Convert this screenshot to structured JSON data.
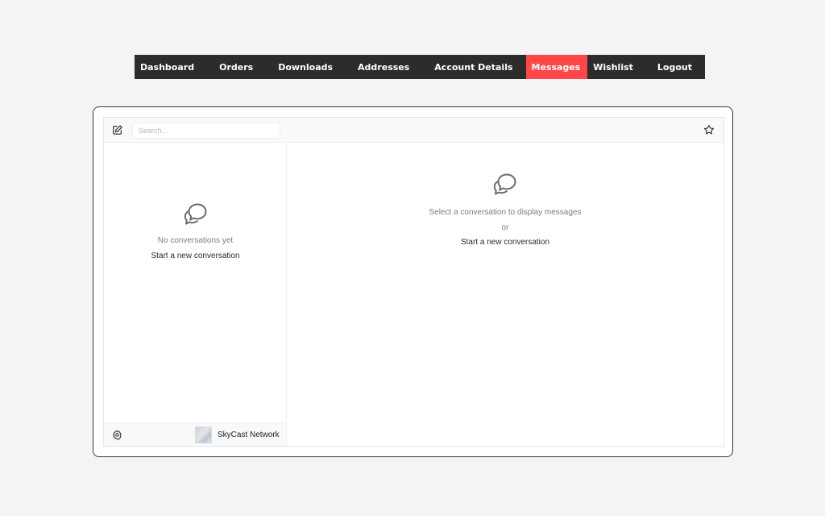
{
  "nav": {
    "items": [
      {
        "label": "Dashboard"
      },
      {
        "label": "Orders"
      },
      {
        "label": "Downloads"
      },
      {
        "label": "Addresses"
      },
      {
        "label": "Account Details"
      },
      {
        "label": "Messages"
      },
      {
        "label": "Wishlist"
      },
      {
        "label": "Logout"
      }
    ],
    "active": "Messages",
    "active_color": "#ff4747",
    "bar_color": "#2c2c2c"
  },
  "inbox": {
    "toolbar": {
      "compose_icon": "pencil-square-icon",
      "search_placeholder": "Search...",
      "star_icon": "star-icon"
    },
    "sidebar": {
      "empty_icon": "chat-bubbles-icon",
      "empty_text": "No conversations yet",
      "start_link": "Start a new conversation"
    },
    "main": {
      "empty_icon": "chat-bubbles-icon",
      "prompt_text": "Select a conversation to display messages",
      "or_text": "or",
      "start_link": "Start a new conversation"
    },
    "footer": {
      "settings_icon": "gear-icon",
      "account_name": "SkyCast Network"
    }
  }
}
